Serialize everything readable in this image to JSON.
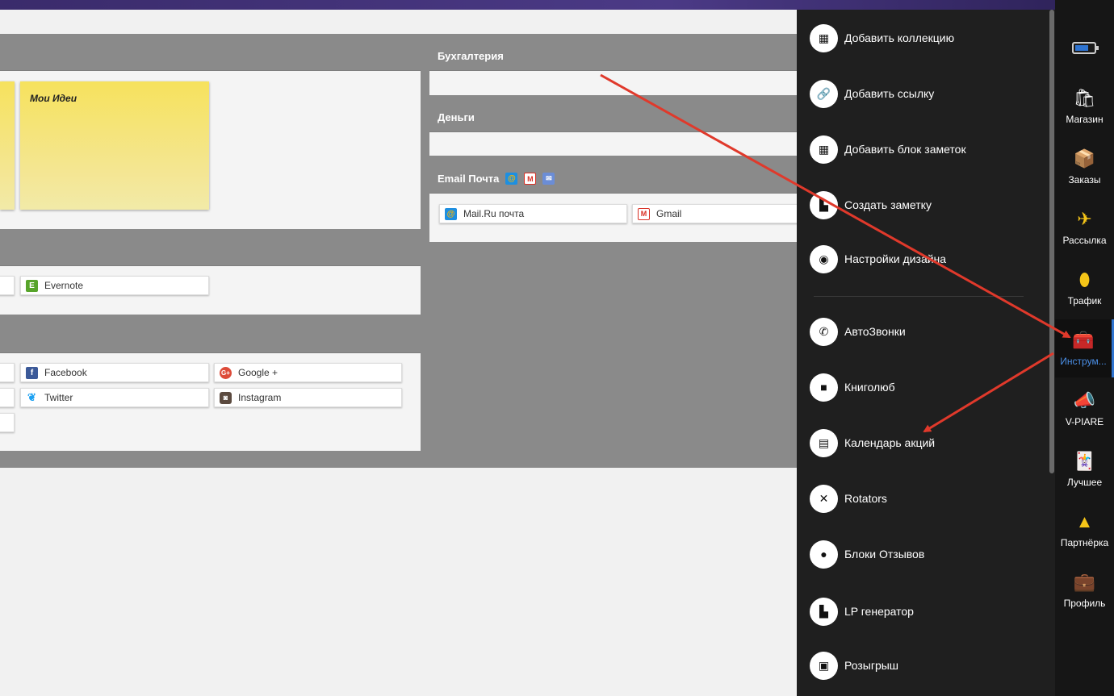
{
  "panels": {
    "notes": {
      "sticky_title": "Мои Идеи"
    },
    "services": {
      "evernote": "Evernote"
    },
    "social": {
      "facebook": "Facebook",
      "google": "Google +",
      "twitter": "Twitter",
      "instagram": "Instagram"
    },
    "buhgalteria": {
      "title": "Бухгалтерия"
    },
    "dengi": {
      "title": "Деньги"
    },
    "email": {
      "title": "Email Почта",
      "mailru": "Mail.Ru почта",
      "gmail": "Gmail"
    }
  },
  "menu": {
    "add_collection": "Добавить коллекцию",
    "add_link": "Добавить ссылку",
    "add_notes_block": "Добавить блок заметок",
    "create_note": "Создать заметку",
    "design_settings": "Настройки дизайна",
    "autocalls": "АвтоЗвонки",
    "knigolyub": "Книголюб",
    "promo_calendar": "Календарь акций",
    "rotators": "Rotators",
    "reviews": "Блоки Отзывов",
    "lp_generator": "LP генератор",
    "giveaway": "Розыгрыш"
  },
  "rail": {
    "shop": "Магазин",
    "orders": "Заказы",
    "mailing": "Рассылка",
    "traffic": "Трафик",
    "tools": "Инструм...",
    "vpiare": "V-PIARE",
    "best": "Лучшее",
    "partner": "Партнёрка",
    "profile": "Профиль"
  },
  "colors": {
    "accent": "#2f74d0",
    "arrow": "#e0392b",
    "sticky": "#f6e25d"
  }
}
